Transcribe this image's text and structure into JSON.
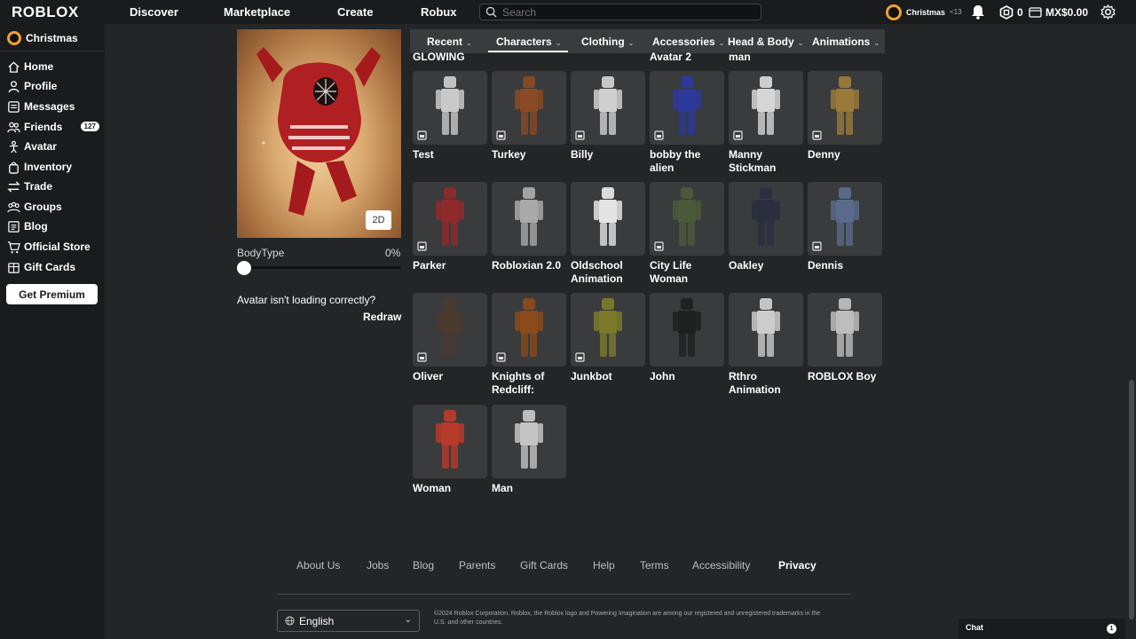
{
  "header": {
    "logo": "ROBLOX",
    "nav": [
      "Discover",
      "Marketplace",
      "Create",
      "Robux"
    ],
    "search_placeholder": "Search",
    "username": "Christmas",
    "age_tag": "<13",
    "robux": "0",
    "currency": "MX$0.00"
  },
  "sidebar": {
    "username": "Christmas",
    "items": [
      {
        "label": "Home",
        "icon": "home-icon"
      },
      {
        "label": "Profile",
        "icon": "profile-icon"
      },
      {
        "label": "Messages",
        "icon": "messages-icon"
      },
      {
        "label": "Friends",
        "icon": "friends-icon",
        "badge": "127"
      },
      {
        "label": "Avatar",
        "icon": "avatar-icon"
      },
      {
        "label": "Inventory",
        "icon": "inventory-icon"
      },
      {
        "label": "Trade",
        "icon": "trade-icon"
      },
      {
        "label": "Groups",
        "icon": "groups-icon"
      },
      {
        "label": "Blog",
        "icon": "blog-icon"
      },
      {
        "label": "Official Store",
        "icon": "store-icon"
      },
      {
        "label": "Gift Cards",
        "icon": "giftcard-icon"
      }
    ],
    "premium_label": "Get Premium"
  },
  "avatar_panel": {
    "view_toggle": "2D",
    "bodytype_label": "BodyType",
    "bodytype_value": "0%",
    "bodytype_level": 0,
    "loading_question": "Avatar isn't loading correctly?",
    "redraw_label": "Redraw"
  },
  "tabs": [
    "Recent",
    "Characters",
    "Clothing",
    "Accessories",
    "Head & Body",
    "Animations"
  ],
  "active_tab": "Characters",
  "partial_labels": [
    "GLOWING",
    "Avatar 2",
    "man"
  ],
  "characters": [
    {
      "name": "Test",
      "color": "#c9c9c9"
    },
    {
      "name": "Turkey",
      "color": "#8a4a24"
    },
    {
      "name": "Billy",
      "color": "#cfcfcf"
    },
    {
      "name": "bobby the alien",
      "color": "#2b3a9a"
    },
    {
      "name": "Manny Stickman",
      "color": "#d6d6d6"
    },
    {
      "name": "Denny",
      "color": "#9a7a3a"
    },
    {
      "name": "Parker",
      "color": "#8e2a2a"
    },
    {
      "name": "Robloxian 2.0",
      "color": "#a9a9a9"
    },
    {
      "name": "Oldschool Animation",
      "color": "#e4e4e4"
    },
    {
      "name": "City Life Woman",
      "color": "#4c5a3a"
    },
    {
      "name": "Oakley",
      "color": "#2a2e3e"
    },
    {
      "name": "Dennis",
      "color": "#5a6a8a"
    },
    {
      "name": "Oliver",
      "color": "#4a3a2e"
    },
    {
      "name": "Knights of Redcliff:",
      "color": "#8a4a1a"
    },
    {
      "name": "Junkbot",
      "color": "#7a7a2a"
    },
    {
      "name": "John",
      "color": "#1e221e"
    },
    {
      "name": "Rthro Animation",
      "color": "#cccccc"
    },
    {
      "name": "ROBLOX Boy",
      "color": "#bdbdbd"
    },
    {
      "name": "Woman",
      "color": "#b83a2a"
    },
    {
      "name": "Man",
      "color": "#c4c4c4"
    }
  ],
  "footer": {
    "links": [
      "About Us",
      "Jobs",
      "Blog",
      "Parents",
      "Gift Cards",
      "Help",
      "Terms",
      "Accessibility",
      "Privacy"
    ],
    "language": "English",
    "copyright": "©2024 Roblox Corporation. Roblox, the Roblox logo and Powering Imagination are among our registered and unregistered trademarks in the U.S. and other countries."
  },
  "chat": {
    "label": "Chat",
    "count": "1"
  }
}
